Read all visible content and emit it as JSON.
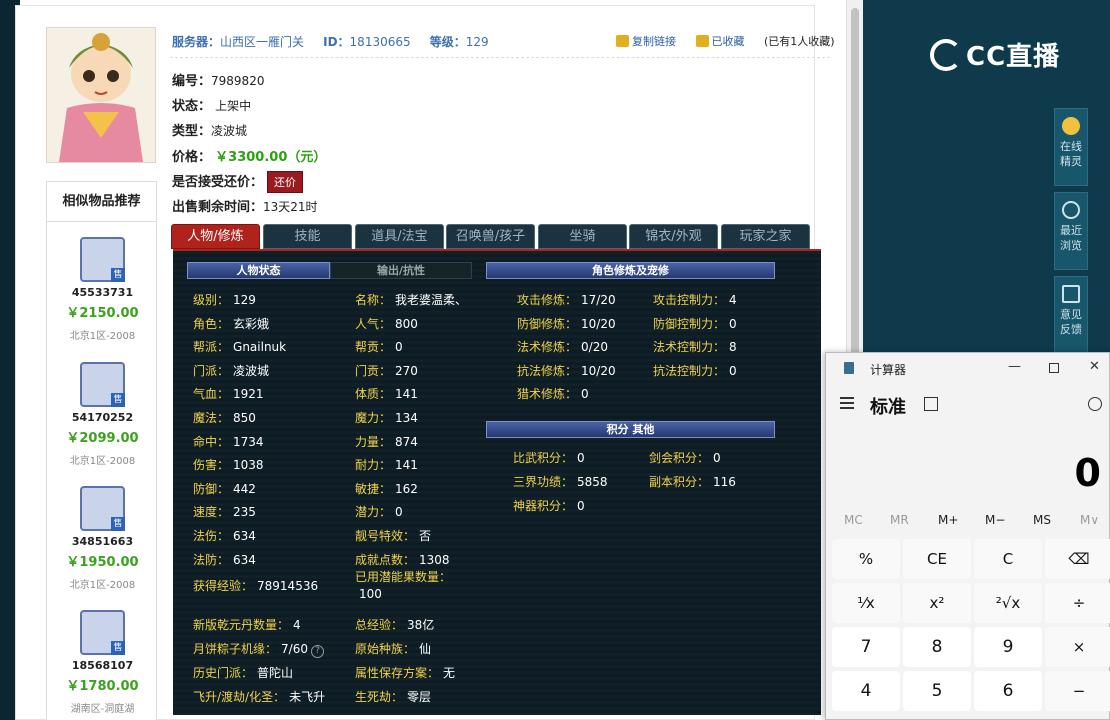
{
  "listing": {
    "server_label": "服务器：",
    "server": "山西区一雁门关",
    "id_label": "ID：",
    "id": "18130665",
    "level_label": "等级：",
    "level": "129",
    "copy_link": "复制链接",
    "favorited": "已收藏",
    "fav_count": "(已有1人收藏)",
    "number_label": "编号：",
    "number": "7989820",
    "status_label": "状态：",
    "status": "上架中",
    "type_label": "类型：",
    "type": "凌波城",
    "price_label": "价格：",
    "price": "￥3300.00（元）",
    "counter_label": "是否接受还价：",
    "counter_btn": "还价",
    "remaining_label": "出售剩余时间：",
    "remaining": "13天21时"
  },
  "similar": {
    "title": "相似物品推荐",
    "items": [
      {
        "id": "45533731",
        "price": "￥2150.00",
        "server": "北京1区-2008"
      },
      {
        "id": "54170252",
        "price": "￥2099.00",
        "server": "北京1区-2008"
      },
      {
        "id": "34851663",
        "price": "￥1950.00",
        "server": "北京1区-2008"
      },
      {
        "id": "18568107",
        "price": "￥1780.00",
        "server": "湖南区-洞庭湖"
      }
    ],
    "sale_badge": "售"
  },
  "tabs": [
    "人物/修炼",
    "技能",
    "道具/法宝",
    "召唤兽/孩子",
    "坐骑",
    "锦衣/外观",
    "玩家之家"
  ],
  "panel": {
    "h_status": "人物状态",
    "h_output": "输出/抗性",
    "h_cultivation": "角色修炼及宠修",
    "h_points": "积分 其他",
    "left_col": [
      {
        "k": "级别：",
        "v": "129"
      },
      {
        "k": "角色：",
        "v": "玄彩娥"
      },
      {
        "k": "帮派：",
        "v": "Gnailnuk"
      },
      {
        "k": "门派：",
        "v": "凌波城"
      },
      {
        "k": "气血：",
        "v": "1921"
      },
      {
        "k": "魔法：",
        "v": "850"
      },
      {
        "k": "命中：",
        "v": "1734"
      },
      {
        "k": "伤害：",
        "v": "1038"
      },
      {
        "k": "防御：",
        "v": "442"
      },
      {
        "k": "速度：",
        "v": "235"
      },
      {
        "k": "法伤：",
        "v": "634"
      },
      {
        "k": "法防：",
        "v": "634"
      }
    ],
    "mid_col": [
      {
        "k": "名称：",
        "v": "我老婆温柔、"
      },
      {
        "k": "人气：",
        "v": "800"
      },
      {
        "k": "帮贡：",
        "v": "0"
      },
      {
        "k": "门贡：",
        "v": "270"
      },
      {
        "k": "体质：",
        "v": "141"
      },
      {
        "k": "魔力：",
        "v": "134"
      },
      {
        "k": "力量：",
        "v": "874"
      },
      {
        "k": "耐力：",
        "v": "141"
      },
      {
        "k": "敏捷：",
        "v": "162"
      },
      {
        "k": "潜力：",
        "v": "0"
      },
      {
        "k": "靓号特效：",
        "v": "否"
      },
      {
        "k": "成就点数：",
        "v": "1308"
      }
    ],
    "exp_label": "获得经验：",
    "exp": "78914536",
    "used_potential_label": "已用潜能果数量：",
    "used_potential": "100",
    "dan_label": "新版乾元丹数量：",
    "dan": "4",
    "total_exp_label": "总经验：",
    "total_exp": "38亿",
    "zongzi_label": "月饼粽子机缘：",
    "zongzi": "7/60",
    "race_label": "原始种族：",
    "race": "仙",
    "hist_label": "历史门派：",
    "hist": "普陀山",
    "attr_label": "属性保存方案：",
    "attr": "无",
    "fly_label": "飞升/渡劫/化圣：",
    "fly": "未飞升",
    "death_label": "生死劫：",
    "death": "零层",
    "cult": [
      {
        "k": "攻击修炼：",
        "v": "17/20",
        "k2": "攻击控制力：",
        "v2": "4"
      },
      {
        "k": "防御修炼：",
        "v": "10/20",
        "k2": "防御控制力：",
        "v2": "0"
      },
      {
        "k": "法术修炼：",
        "v": "0/20",
        "k2": "法术控制力：",
        "v2": "8"
      },
      {
        "k": "抗法修炼：",
        "v": "10/20",
        "k2": "抗法控制力：",
        "v2": "0"
      },
      {
        "k": "猎术修炼：",
        "v": "0",
        "k2": "",
        "v2": ""
      }
    ],
    "points": [
      {
        "k": "比武积分：",
        "v": "0",
        "k2": "剑会积分：",
        "v2": "0"
      },
      {
        "k": "三界功绩：",
        "v": "5858",
        "k2": "副本积分：",
        "v2": "116"
      },
      {
        "k": "神器积分：",
        "v": "0",
        "k2": "",
        "v2": ""
      }
    ]
  },
  "sidebar": {
    "brand": "CC直播",
    "rail": [
      "在线精灵",
      "最近浏览",
      "意见反馈"
    ]
  },
  "calculator": {
    "title": "计算器",
    "mode": "标准",
    "display": "0",
    "memory": [
      "MC",
      "MR",
      "M+",
      "M−",
      "MS",
      "M∨"
    ],
    "keys": [
      [
        "%",
        "CE",
        "C",
        "⌫"
      ],
      [
        "¹⁄x",
        "x²",
        "²√x",
        "÷"
      ],
      [
        "7",
        "8",
        "9",
        "×"
      ],
      [
        "4",
        "5",
        "6",
        "−"
      ]
    ]
  }
}
